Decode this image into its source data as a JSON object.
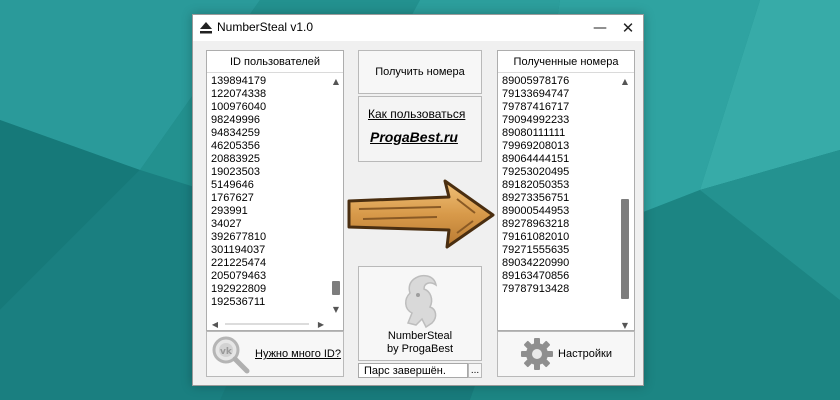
{
  "window": {
    "title": "NumberSteal v1.0",
    "minimize_glyph": "—",
    "close_glyph": "✕"
  },
  "left_panel": {
    "header": "ID пользователей",
    "ids": [
      "139894179",
      "122074338",
      "100976040",
      "98249996",
      "94834259",
      "46205356",
      "20883925",
      "19023503",
      "5149646",
      "1767627",
      "293991",
      "34027",
      "392677810",
      "301194037",
      "221225474",
      "205079463",
      "192922809",
      "192536711"
    ],
    "scroll_position": 0.93
  },
  "center": {
    "get_numbers_button": "Получить номера",
    "how_to_link": "Как пользоваться",
    "site_link": "ProgaBest.ru",
    "arrow_icon": "big-arrow-right-icon",
    "logo_title": "NumberSteal",
    "logo_subtitle": "by ProgaBest",
    "status_text": "Парс завершён.",
    "browse_button": "..."
  },
  "right_panel": {
    "header": "Полученные номера",
    "numbers": [
      "89005978176",
      "79133694747",
      "79787416717",
      "79094992233",
      "89080111111",
      "79969208013",
      "89064444151",
      "79253020495",
      "89182050353",
      "89273356751",
      "89000544953",
      "89278963218",
      "79161082010",
      "79271555635",
      "89034220990",
      "89163470856",
      "79787913428"
    ],
    "scroll_position": 0.9
  },
  "bottom_left": {
    "label": "Нужно много ID?",
    "icon": "magnifier-vk-icon"
  },
  "bottom_right": {
    "label": "Настройки",
    "icon": "gear-icon"
  },
  "colors": {
    "desktop": "#1f8a8a",
    "window": "#f0f0f0",
    "scroll_thumb": "#7d7d7d",
    "arrow": "#d9a55a"
  }
}
